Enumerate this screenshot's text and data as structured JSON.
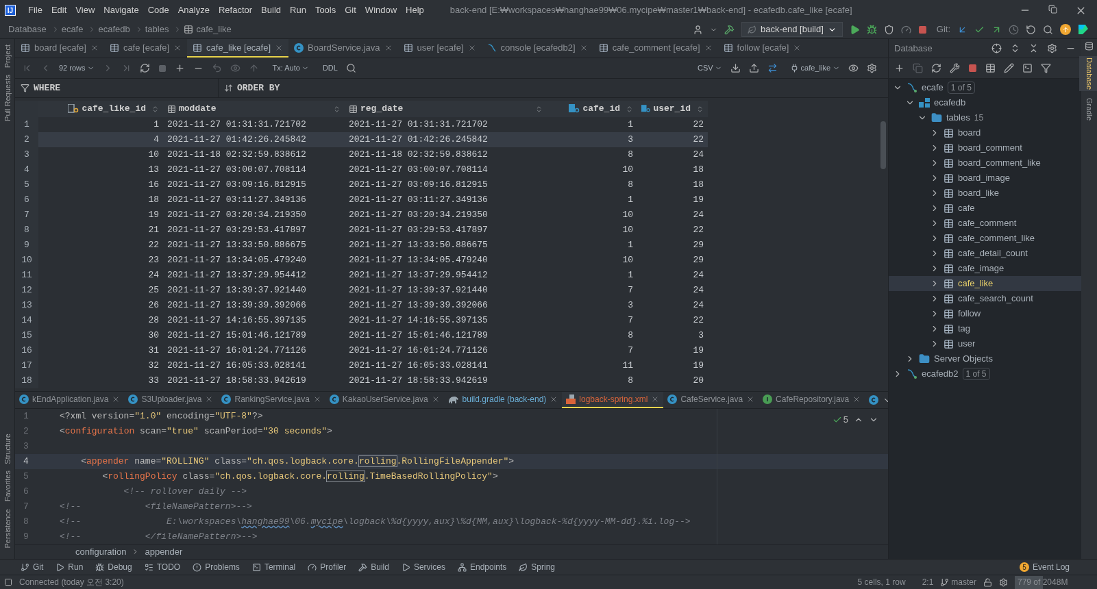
{
  "menu_bar": {
    "logo_text": "IJ",
    "items": [
      "File",
      "Edit",
      "View",
      "Navigate",
      "Code",
      "Analyze",
      "Refactor",
      "Build",
      "Run",
      "Tools",
      "Git",
      "Window",
      "Help"
    ],
    "title": "back-end [E:₩workspaces₩hanghae99₩06.mycipe₩master1₩back-end] - ecafedb.cafe_like [ecafe]"
  },
  "breadcrumbs": [
    "Database",
    "ecafe",
    "ecafedb",
    "tables",
    "cafe_like"
  ],
  "toolbar": {
    "run_config": "back-end [build]",
    "git_label": "Git:"
  },
  "left_strip": [
    {
      "label": "Project",
      "selected": false
    },
    {
      "label": "Pull Requests",
      "selected": false
    },
    {
      "label": "Structure",
      "selected": false
    },
    {
      "label": "Favorites",
      "selected": false
    },
    {
      "label": "Persistence",
      "selected": false
    }
  ],
  "right_strip": [
    {
      "label": "Database",
      "selected": true
    },
    {
      "label": "Gradle",
      "selected": false
    }
  ],
  "tabs": [
    {
      "label": "board [ecafe]",
      "kind": "table",
      "selected": false
    },
    {
      "label": "cafe [ecafe]",
      "kind": "table",
      "selected": false
    },
    {
      "label": "cafe_like [ecafe]",
      "kind": "table",
      "selected": true
    },
    {
      "label": "BoardService.java",
      "kind": "class",
      "selected": false
    },
    {
      "label": "user [ecafe]",
      "kind": "table",
      "selected": false
    },
    {
      "label": "console [ecafedb2]",
      "kind": "console",
      "selected": false
    },
    {
      "label": "cafe_comment [ecafe]",
      "kind": "table",
      "selected": false
    },
    {
      "label": "follow [ecafe]",
      "kind": "table",
      "selected": false
    }
  ],
  "data_toolbar": {
    "rows": "92 rows",
    "tx": "Tx: Auto",
    "ddl": "DDL",
    "format": "CSV",
    "table": "cafe_like"
  },
  "filter": {
    "where": "WHERE",
    "order_by": "ORDER BY"
  },
  "table": {
    "columns": [
      {
        "name": "cafe_like_id",
        "kind": "primary_key"
      },
      {
        "name": "moddate",
        "kind": "plain"
      },
      {
        "name": "reg_date",
        "kind": "plain"
      },
      {
        "name": "cafe_id",
        "kind": "foreign_key"
      },
      {
        "name": "user_id",
        "kind": "foreign_key"
      }
    ],
    "rows": [
      {
        "number": "1",
        "selected": false,
        "cells": [
          "1",
          "2021-11-27 01:31:31.721702",
          "2021-11-27 01:31:31.721702",
          "1",
          "22"
        ]
      },
      {
        "number": "2",
        "selected": true,
        "cells": [
          "4",
          "2021-11-27 01:42:26.245842",
          "2021-11-27 01:42:26.245842",
          "3",
          "22"
        ]
      },
      {
        "number": "3",
        "selected": false,
        "cells": [
          "10",
          "2021-11-18 02:32:59.838612",
          "2021-11-18 02:32:59.838612",
          "8",
          "24"
        ]
      },
      {
        "number": "4",
        "selected": false,
        "cells": [
          "13",
          "2021-11-27 03:00:07.708114",
          "2021-11-27 03:00:07.708114",
          "10",
          "18"
        ]
      },
      {
        "number": "5",
        "selected": false,
        "cells": [
          "16",
          "2021-11-27 03:09:16.812915",
          "2021-11-27 03:09:16.812915",
          "8",
          "18"
        ]
      },
      {
        "number": "6",
        "selected": false,
        "cells": [
          "18",
          "2021-11-27 03:11:27.349136",
          "2021-11-27 03:11:27.349136",
          "1",
          "19"
        ]
      },
      {
        "number": "7",
        "selected": false,
        "cells": [
          "19",
          "2021-11-27 03:20:34.219350",
          "2021-11-27 03:20:34.219350",
          "10",
          "24"
        ]
      },
      {
        "number": "8",
        "selected": false,
        "cells": [
          "21",
          "2021-11-27 03:29:53.417897",
          "2021-11-27 03:29:53.417897",
          "10",
          "22"
        ]
      },
      {
        "number": "9",
        "selected": false,
        "cells": [
          "22",
          "2021-11-27 13:33:50.886675",
          "2021-11-27 13:33:50.886675",
          "1",
          "29"
        ]
      },
      {
        "number": "10",
        "selected": false,
        "cells": [
          "23",
          "2021-11-27 13:34:05.479240",
          "2021-11-27 13:34:05.479240",
          "10",
          "29"
        ]
      },
      {
        "number": "11",
        "selected": false,
        "cells": [
          "24",
          "2021-11-27 13:37:29.954412",
          "2021-11-27 13:37:29.954412",
          "1",
          "24"
        ]
      },
      {
        "number": "12",
        "selected": false,
        "cells": [
          "25",
          "2021-11-27 13:39:37.921440",
          "2021-11-27 13:39:37.921440",
          "7",
          "24"
        ]
      },
      {
        "number": "13",
        "selected": false,
        "cells": [
          "26",
          "2021-11-27 13:39:39.392066",
          "2021-11-27 13:39:39.392066",
          "3",
          "24"
        ]
      },
      {
        "number": "14",
        "selected": false,
        "cells": [
          "28",
          "2021-11-27 14:16:55.397135",
          "2021-11-27 14:16:55.397135",
          "7",
          "22"
        ]
      },
      {
        "number": "15",
        "selected": false,
        "cells": [
          "30",
          "2021-11-27 15:01:46.121789",
          "2021-11-27 15:01:46.121789",
          "8",
          "3"
        ]
      },
      {
        "number": "16",
        "selected": false,
        "cells": [
          "31",
          "2021-11-27 16:01:24.771126",
          "2021-11-27 16:01:24.771126",
          "7",
          "19"
        ]
      },
      {
        "number": "17",
        "selected": false,
        "cells": [
          "32",
          "2021-11-27 16:05:33.028141",
          "2021-11-27 16:05:33.028141",
          "11",
          "19"
        ]
      },
      {
        "number": "18",
        "selected": false,
        "cells": [
          "33",
          "2021-11-27 18:58:33.942619",
          "2021-11-27 18:58:33.942619",
          "8",
          "20"
        ]
      }
    ]
  },
  "editor_tabs": [
    {
      "label": "kEndApplication.java",
      "kind": "class",
      "selected": false
    },
    {
      "label": "S3Uploader.java",
      "kind": "class",
      "selected": false
    },
    {
      "label": "RankingService.java",
      "kind": "class",
      "selected": false
    },
    {
      "label": "KakaoUserService.java",
      "kind": "class",
      "selected": false
    },
    {
      "label": "build.gradle (back-end)",
      "kind": "gradle",
      "selected": false
    },
    {
      "label": "logback-spring.xml",
      "kind": "xml",
      "selected": true
    },
    {
      "label": "CafeService.java",
      "kind": "class",
      "selected": false
    },
    {
      "label": "CafeRepository.java",
      "kind": "interface",
      "selected": false
    }
  ],
  "editor": {
    "inspection_count": "5",
    "lines": [
      {
        "number": "1",
        "current": false,
        "tokens": [
          {
            "kind": "punct",
            "text": "<?xml "
          },
          {
            "kind": "attr",
            "text": "version="
          },
          {
            "kind": "string",
            "text": "\"1.0\""
          },
          {
            "kind": "attr",
            "text": " encoding="
          },
          {
            "kind": "string",
            "text": "\"UTF-8\""
          },
          {
            "kind": "punct",
            "text": "?>"
          }
        ]
      },
      {
        "number": "2",
        "current": false,
        "tokens": [
          {
            "kind": "punct",
            "text": "<"
          },
          {
            "kind": "tag",
            "text": "configuration"
          },
          {
            "kind": "attr",
            "text": " scan="
          },
          {
            "kind": "string",
            "text": "\"true\""
          },
          {
            "kind": "attr",
            "text": " scanPeriod="
          },
          {
            "kind": "string",
            "text": "\"30 seconds\""
          },
          {
            "kind": "punct",
            "text": ">"
          }
        ]
      },
      {
        "number": "3",
        "current": false
      },
      {
        "number": "4",
        "current": true,
        "tokens": [
          {
            "kind": "punct",
            "text": "    <"
          },
          {
            "kind": "tag",
            "text": "appender"
          },
          {
            "kind": "attr",
            "text": " name="
          },
          {
            "kind": "string",
            "text": "\"ROLLING\""
          },
          {
            "kind": "attr",
            "text": " class="
          },
          {
            "kind": "string",
            "text": "\"ch.qos.logback.core."
          },
          {
            "kind": "match",
            "text": "rolling"
          },
          {
            "kind": "string",
            "text": ".RollingFileAppender\""
          },
          {
            "kind": "punct",
            "text": ">"
          }
        ]
      },
      {
        "number": "5",
        "current": false,
        "tokens": [
          {
            "kind": "punct",
            "text": "        <"
          },
          {
            "kind": "tag",
            "text": "rollingPolicy"
          },
          {
            "kind": "attr",
            "text": " class="
          },
          {
            "kind": "string",
            "text": "\"ch.qos.logback.core."
          },
          {
            "kind": "match",
            "text": "rolling"
          },
          {
            "kind": "string",
            "text": ".TimeBasedRollingPolicy\""
          },
          {
            "kind": "punct",
            "text": ">"
          }
        ]
      },
      {
        "number": "6",
        "current": false,
        "tokens": [
          {
            "kind": "comment",
            "text": "            <!-- rollover daily -->"
          }
        ]
      },
      {
        "number": "7",
        "current": false,
        "tokens": [
          {
            "kind": "comment",
            "text": "<!--            <fileNamePattern>-->"
          }
        ]
      },
      {
        "number": "8",
        "current": false,
        "tokens": [
          {
            "kind": "comment",
            "text": "<!--                E:\\workspaces\\"
          },
          {
            "kind": "typo",
            "text": "hanghae99"
          },
          {
            "kind": "comment",
            "text": "\\06."
          },
          {
            "kind": "typo",
            "text": "mycipe"
          },
          {
            "kind": "comment",
            "text": "\\logback\\%d{yyyy,aux}\\%d{MM,aux}\\logback-%d{yyyy-MM-dd}.%i.log-->"
          }
        ]
      },
      {
        "number": "9",
        "current": false,
        "tokens": [
          {
            "kind": "comment",
            "text": "<!--            </fileNamePattern>-->"
          }
        ]
      }
    ],
    "breadcrumbs": [
      "configuration",
      "appender"
    ]
  },
  "database_panel": {
    "title": "Database",
    "tree": [
      {
        "label": "ecafe",
        "kind": "datasource",
        "badge": "1 of 5",
        "expanded": true,
        "selected": false,
        "children": [
          {
            "label": "ecafedb",
            "kind": "schema",
            "expanded": true,
            "selected": false,
            "children": [
              {
                "label": "tables",
                "kind": "folder",
                "count": "15",
                "expanded": true,
                "selected": false,
                "children": [
                  {
                    "label": "board",
                    "kind": "table",
                    "expanded": false,
                    "selected": false
                  },
                  {
                    "label": "board_comment",
                    "kind": "table",
                    "expanded": false,
                    "selected": false
                  },
                  {
                    "label": "board_comment_like",
                    "kind": "table",
                    "expanded": false,
                    "selected": false
                  },
                  {
                    "label": "board_image",
                    "kind": "table",
                    "expanded": false,
                    "selected": false
                  },
                  {
                    "label": "board_like",
                    "kind": "table",
                    "expanded": false,
                    "selected": false
                  },
                  {
                    "label": "cafe",
                    "kind": "table",
                    "expanded": false,
                    "selected": false
                  },
                  {
                    "label": "cafe_comment",
                    "kind": "table",
                    "expanded": false,
                    "selected": false
                  },
                  {
                    "label": "cafe_comment_like",
                    "kind": "table",
                    "expanded": false,
                    "selected": false
                  },
                  {
                    "label": "cafe_detail_count",
                    "kind": "table",
                    "expanded": false,
                    "selected": false
                  },
                  {
                    "label": "cafe_image",
                    "kind": "table",
                    "expanded": false,
                    "selected": false
                  },
                  {
                    "label": "cafe_like",
                    "kind": "table",
                    "expanded": false,
                    "selected": true
                  },
                  {
                    "label": "cafe_search_count",
                    "kind": "table",
                    "expanded": false,
                    "selected": false
                  },
                  {
                    "label": "follow",
                    "kind": "table",
                    "expanded": false,
                    "selected": false
                  },
                  {
                    "label": "tag",
                    "kind": "table",
                    "expanded": false,
                    "selected": false
                  },
                  {
                    "label": "user",
                    "kind": "table",
                    "expanded": false,
                    "selected": false
                  }
                ]
              }
            ]
          },
          {
            "label": "Server Objects",
            "kind": "folder",
            "expanded": false,
            "selected": false
          }
        ]
      },
      {
        "label": "ecafedb2",
        "kind": "datasource",
        "badge": "1 of 5",
        "expanded": false,
        "selected": false
      }
    ]
  },
  "tool_windows": [
    "Git",
    "Run",
    "Debug",
    "TODO",
    "Problems",
    "Terminal",
    "Profiler",
    "Build",
    "Services",
    "Endpoints",
    "Spring"
  ],
  "event_log": {
    "label": "Event Log",
    "count": "5"
  },
  "status_bar": {
    "message": "Connected (today 오전 3:20)",
    "selection": "5 cells, 1 row",
    "position": "2:1",
    "branch": "master",
    "memory": {
      "label": "779 of 2048M",
      "level": 0.38
    }
  }
}
